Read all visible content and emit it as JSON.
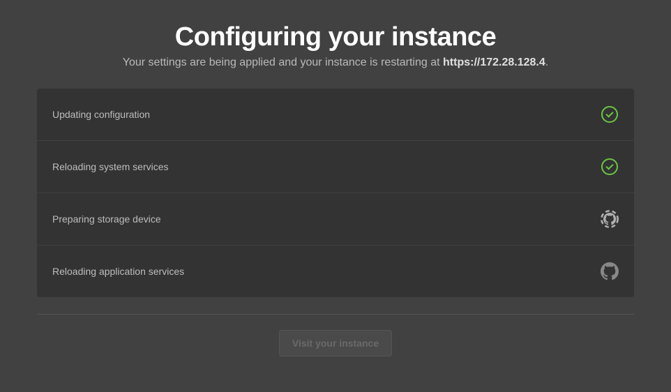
{
  "header": {
    "title": "Configuring your instance",
    "subtitle_prefix": "Your settings are being applied and your instance is restarting at ",
    "subtitle_url": "https://172.28.128.4",
    "subtitle_suffix": "."
  },
  "steps": [
    {
      "label": "Updating configuration",
      "status": "done"
    },
    {
      "label": "Reloading system services",
      "status": "done"
    },
    {
      "label": "Preparing storage device",
      "status": "active"
    },
    {
      "label": "Reloading application services",
      "status": "pending"
    }
  ],
  "footer": {
    "visit_button_label": "Visit your instance"
  }
}
